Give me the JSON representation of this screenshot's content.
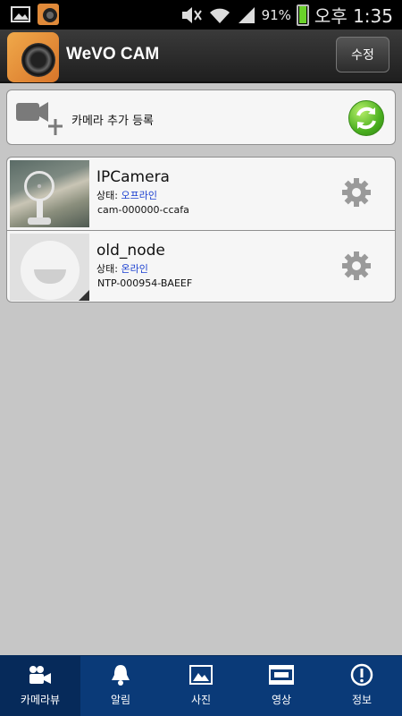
{
  "status_bar": {
    "battery_percent": "91%",
    "time": "오후 1:35",
    "battery_level": 0.91
  },
  "header": {
    "title": "WeVO CAM",
    "edit_label": "수정"
  },
  "add_camera": {
    "label": "카메라 추가 등록"
  },
  "cameras": [
    {
      "name": "IPCamera",
      "status_prefix": "상태: ",
      "status": "오프라인",
      "id": "cam-000000-ccafa"
    },
    {
      "name": "old_node",
      "status_prefix": "상태: ",
      "status": "온라인",
      "id": "NTP-000954-BAEEF"
    }
  ],
  "tabs": [
    {
      "label": "카메라뷰",
      "icon": "camera-view-icon",
      "active": true
    },
    {
      "label": "알림",
      "icon": "bell-icon",
      "active": false
    },
    {
      "label": "사진",
      "icon": "photo-icon",
      "active": false
    },
    {
      "label": "영상",
      "icon": "film-icon",
      "active": false
    },
    {
      "label": "정보",
      "icon": "info-icon",
      "active": false
    }
  ],
  "colors": {
    "tabbar": "#0a3a78",
    "status_link": "#1a3fd0",
    "refresh_green": "#4bb020"
  }
}
